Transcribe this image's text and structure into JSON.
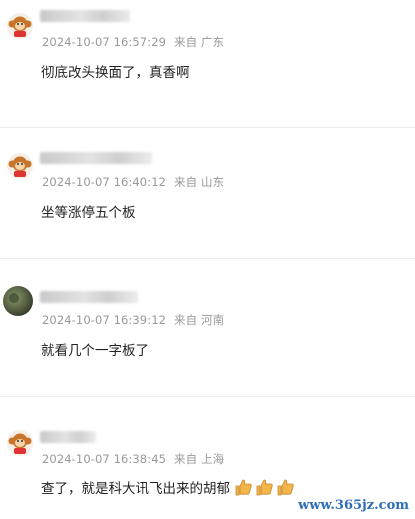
{
  "comments": [
    {
      "time": "2024-10-07 16:57:29",
      "from": "来自",
      "location": "广东",
      "text": "彻底改头换面了，真香啊"
    },
    {
      "time": "2024-10-07 16:40:12",
      "from": "来自",
      "location": "山东",
      "text": "坐等涨停五个板"
    },
    {
      "time": "2024-10-07 16:39:12",
      "from": "来自",
      "location": "河南",
      "text": "就看几个一字板了"
    },
    {
      "time": "2024-10-07 16:38:45",
      "from": "来自",
      "location": "上海",
      "text": "查了，就是科大讯飞出来的胡郁"
    }
  ],
  "icons": {
    "avatar": "monkey-avatar-icon",
    "avatar_photo": "photo-avatar-icon",
    "thumbs": "thumbs-up-icon"
  },
  "watermark": "www.365jz.com"
}
